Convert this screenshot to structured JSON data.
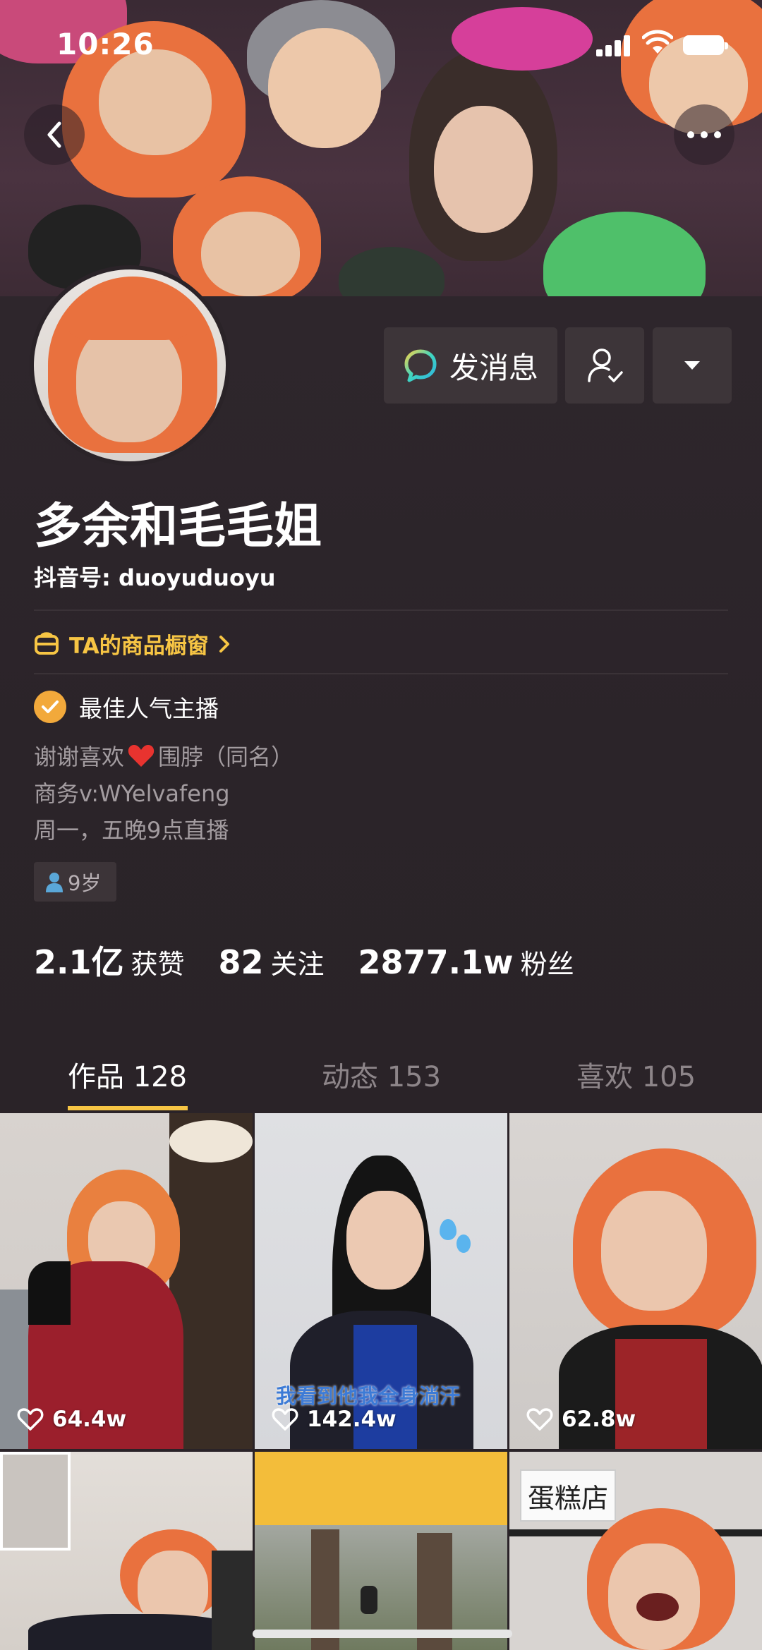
{
  "status_bar": {
    "time": "10:26"
  },
  "profile": {
    "name": "多余和毛毛姐",
    "douyin_id": "抖音号: duoyuduoyu",
    "shop_label": "TA的商品橱窗",
    "verification": "最佳人气主播",
    "bio": [
      "谢谢喜欢",
      "围脖（同名）",
      "商务v:WYelvafeng",
      "周一，五晚9点直播"
    ],
    "age": "9岁"
  },
  "actions": {
    "message_label": "发消息"
  },
  "stats": [
    {
      "value": "2.1亿",
      "label": "获赞"
    },
    {
      "value": "82",
      "label": "关注"
    },
    {
      "value": "2877.1w",
      "label": "粉丝"
    }
  ],
  "tabs": [
    {
      "label": "作品 128",
      "active": true
    },
    {
      "label": "动态 153",
      "active": false
    },
    {
      "label": "喜欢 105",
      "active": false
    }
  ],
  "videos": [
    {
      "likes": "64.4w"
    },
    {
      "likes": "142.4w",
      "caption": "我看到他我全身淌汗"
    },
    {
      "likes": "62.8w"
    },
    {
      "sign_text": "蛋糕店"
    }
  ],
  "colors": {
    "accent": "#f7c544",
    "background": "#2a2328",
    "verify": "#f2a93b"
  }
}
